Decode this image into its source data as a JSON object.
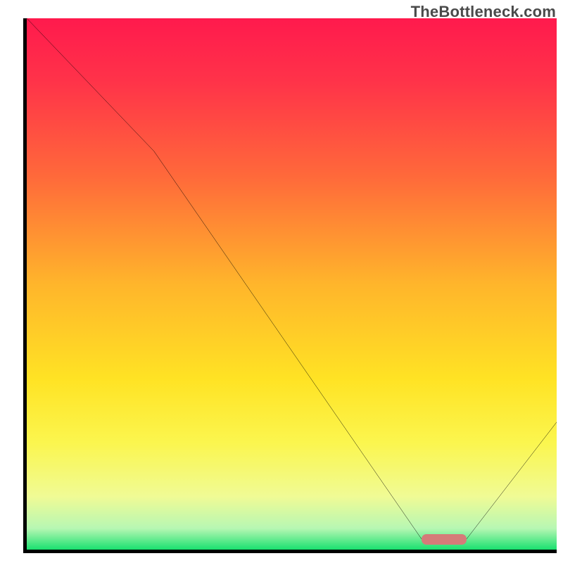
{
  "watermark": "TheBottleneck.com",
  "chart_data": {
    "type": "line",
    "title": "",
    "xlabel": "",
    "ylabel": "",
    "xlim": [
      0,
      100
    ],
    "ylim": [
      0,
      100
    ],
    "grid": false,
    "legend": false,
    "series": [
      {
        "name": "curve",
        "points_x": [
          0,
          24,
          74.5,
          83,
          100
        ],
        "points_y": [
          100,
          75,
          2,
          2,
          24
        ],
        "color": "#000000"
      }
    ],
    "optimal_marker": {
      "x_start": 74.5,
      "x_end": 83,
      "y": 2,
      "color": "#d57b79"
    },
    "gradient_stops": [
      {
        "offset": 0,
        "color": "#ff1a4d"
      },
      {
        "offset": 12,
        "color": "#ff3349"
      },
      {
        "offset": 30,
        "color": "#ff6a3a"
      },
      {
        "offset": 50,
        "color": "#ffb52b"
      },
      {
        "offset": 68,
        "color": "#ffe324"
      },
      {
        "offset": 80,
        "color": "#fbf64f"
      },
      {
        "offset": 90,
        "color": "#f0fb95"
      },
      {
        "offset": 96,
        "color": "#b7f7b3"
      },
      {
        "offset": 100,
        "color": "#19e06f"
      }
    ]
  }
}
